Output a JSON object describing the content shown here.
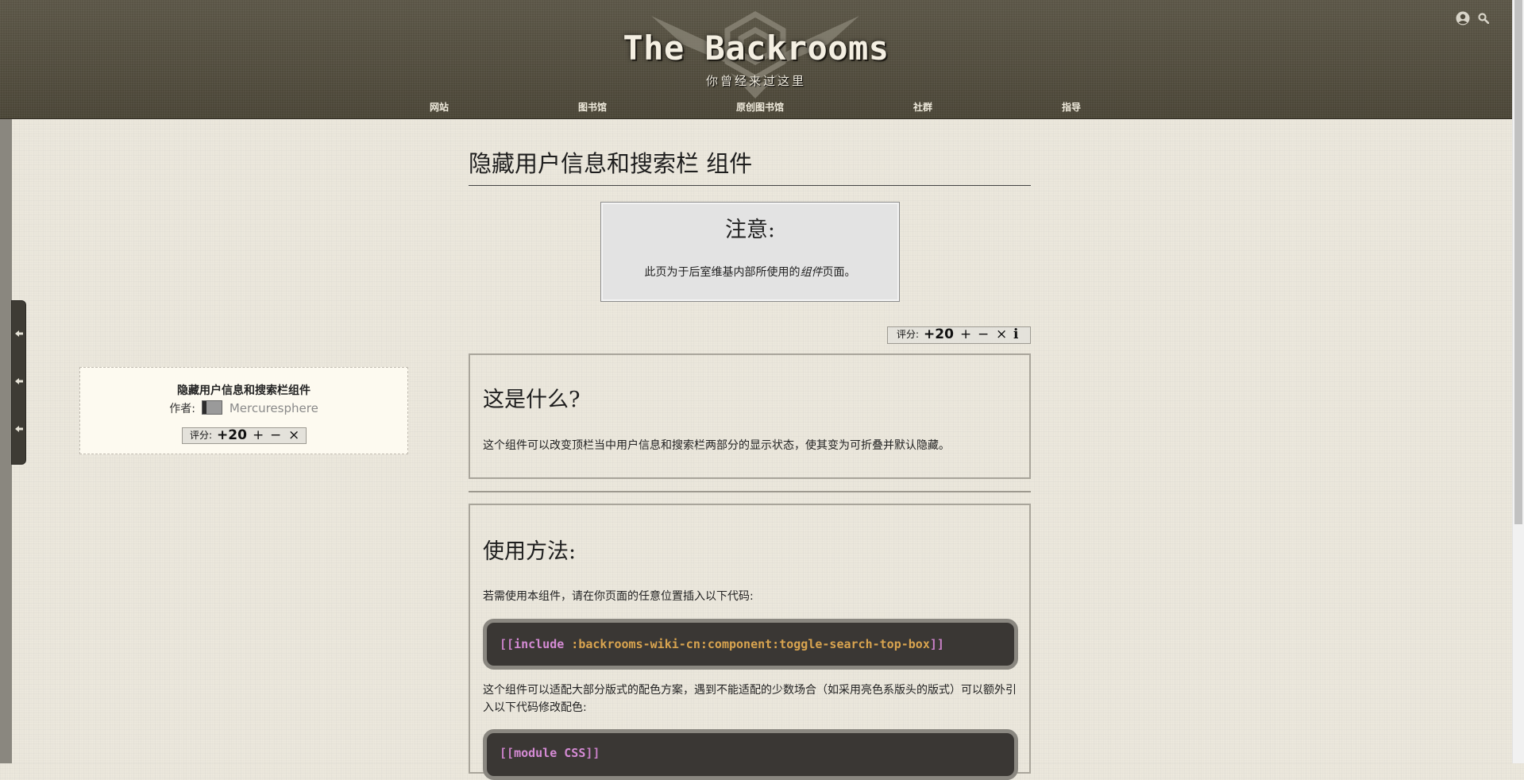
{
  "header": {
    "site_title": "The Backrooms",
    "site_subtitle": "你曾经来过这里",
    "nav": [
      "网站",
      "图书馆",
      "原创图书馆",
      "社群",
      "指导"
    ],
    "icons": [
      "user-icon",
      "search-icon"
    ]
  },
  "page": {
    "title": "隐藏用户信息和搜索栏 组件"
  },
  "notice": {
    "heading": "注意:",
    "text_before": "此页为于后室维基内部所使用的",
    "text_em": "组件",
    "text_after": "页面。"
  },
  "rating": {
    "label": "评分:",
    "score": "+20",
    "plus": "+",
    "minus": "−",
    "cancel": "×",
    "info": "i"
  },
  "info_card": {
    "title": "隐藏用户信息和搜索栏组件",
    "author_label": "作者:",
    "author_name": "Mercuresphere",
    "rating_label": "评分:",
    "rating_score": "+20"
  },
  "sections": {
    "what": {
      "heading": "这是什么?",
      "text": "这个组件可以改变顶栏当中用户信息和搜索栏两部分的显示状态，使其变为可折叠并默认隐藏。"
    },
    "usage": {
      "heading": "使用方法:",
      "intro": "若需使用本组件，请在你页面的任意位置插入以下代码:",
      "code1_open": "[[",
      "code1_keyword": "include",
      "code1_arg": " :backrooms-wiki-cn:component:toggle-search-top-box",
      "code1_close": "]]",
      "text2": "这个组件可以适配大部分版式的配色方案，遇到不能适配的少数场合（如采用亮色系版头的版式）可以额外引入以下代码修改配色:",
      "code2_open": "[[",
      "code2_keyword": "module CSS",
      "code2_close": "]]"
    }
  },
  "colors": {
    "header_bg": "#4f4a3c",
    "page_bg": "#ece8dd",
    "code_bg": "#3a3734",
    "code_keyword": "#d58bd5",
    "code_arg": "#d9a44f"
  }
}
